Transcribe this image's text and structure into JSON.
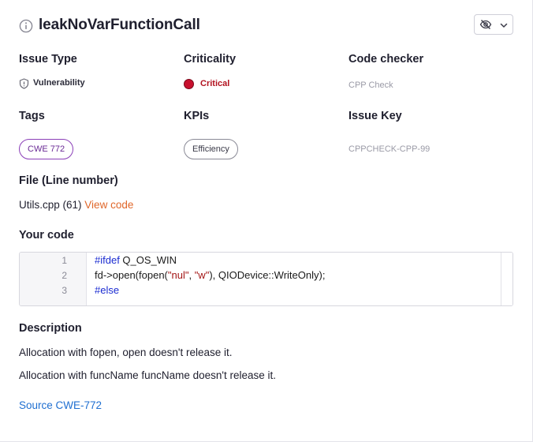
{
  "header": {
    "title": "leakNoVarFunctionCall",
    "info_icon": "info-circle-icon",
    "visibility_icon": "eye-off-icon",
    "dropdown_icon": "chevron-down-icon"
  },
  "fields": {
    "issue_type_label": "Issue Type",
    "issue_type_value": "Vulnerability",
    "criticality_label": "Criticality",
    "criticality_value": "Critical",
    "criticality_color": "#c8102e",
    "code_checker_label": "Code checker",
    "code_checker_value": "CPP Check",
    "tags_label": "Tags",
    "tag_value": "CWE 772",
    "kpis_label": "KPIs",
    "kpi_value": "Efficiency",
    "issue_key_label": "Issue Key",
    "issue_key_value": "CPPCHECK-CPP-99"
  },
  "file": {
    "label": "File (Line number)",
    "value": "Utils.cpp (61)",
    "view_code_link": "View code"
  },
  "code": {
    "label": "Your code",
    "lines": [
      {
        "number": "1",
        "kw": "#ifdef",
        "rest": " Q_OS_WIN"
      },
      {
        "number": "2",
        "p1": "fd->open(fopen(",
        "s1": "\"nul\"",
        "p2": ", ",
        "s2": "\"w\"",
        "p3": "), QIODevice::WriteOnly);"
      },
      {
        "number": "3",
        "kw": "#else"
      }
    ]
  },
  "description": {
    "label": "Description",
    "line1": "Allocation with fopen, open doesn't release it.",
    "line2": "Allocation with funcName funcName doesn't release it.",
    "source_link": "Source CWE-772"
  },
  "colors": {
    "accent_link": "#e0672a",
    "source_link": "#1f6fd1",
    "tag_border": "#8b3fb8"
  }
}
